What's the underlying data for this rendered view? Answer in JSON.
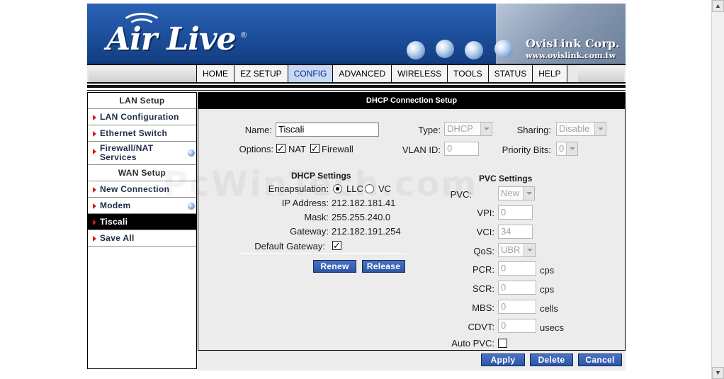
{
  "brand": {
    "logo": "Air Live",
    "reg_mark": "®",
    "corp_name": "OvisLink Corp.",
    "corp_url": "www.ovislink.com.tw"
  },
  "nav": {
    "items": [
      "HOME",
      "EZ SETUP",
      "CONFIG",
      "ADVANCED",
      "WIRELESS",
      "TOOLS",
      "STATUS",
      "HELP"
    ],
    "active": "CONFIG"
  },
  "sidebar": {
    "lan_header": "LAN Setup",
    "lan_configuration": "LAN Configuration",
    "ethernet_switch": "Ethernet Switch",
    "firewall_nat_1": "Firewall/NAT",
    "firewall_nat_2": "Services",
    "wan_header": "WAN Setup",
    "new_connection": "New Connection",
    "modem": "Modem",
    "tiscali": "Tiscali",
    "save_all": "Save All"
  },
  "panel": {
    "title": "DHCP Connection Setup",
    "name_label": "Name:",
    "name_value": "Tiscali",
    "type_label": "Type:",
    "type_value": "DHCP",
    "sharing_label": "Sharing:",
    "sharing_value": "Disable",
    "options_label": "Options:",
    "nat_label": "NAT",
    "firewall_label": "Firewall",
    "vlan_label": "VLAN ID:",
    "vlan_value": "0",
    "priority_label": "Priority Bits:",
    "priority_value": "0"
  },
  "dhcp": {
    "title": "DHCP Settings",
    "encapsulation_label": "Encapsulation:",
    "llc_label": "LLC",
    "vc_label": "VC",
    "ip_label": "IP Address:",
    "ip_value": "212.182.181.41",
    "mask_label": "Mask:",
    "mask_value": "255.255.240.0",
    "gateway_label": "Gateway:",
    "gateway_value": "212.182.191.254",
    "default_gateway_label": "Default Gateway:",
    "renew": "Renew",
    "release": "Release"
  },
  "pvc": {
    "title": "PVC Settings",
    "pvc_label": "PVC:",
    "pvc_value": "New",
    "vpi_label": "VPI:",
    "vpi_value": "0",
    "vci_label": "VCI:",
    "vci_value": "34",
    "qos_label": "QoS:",
    "qos_value": "UBR",
    "pcr_label": "PCR:",
    "pcr_value": "0",
    "pcr_unit": "cps",
    "scr_label": "SCR:",
    "scr_value": "0",
    "scr_unit": "cps",
    "mbs_label": "MBS:",
    "mbs_value": "0",
    "mbs_unit": "cells",
    "cdvt_label": "CDVT:",
    "cdvt_value": "0",
    "cdvt_unit": "usecs",
    "auto_pvc_label": "Auto PVC:"
  },
  "actions": {
    "apply": "Apply",
    "delete": "Delete",
    "cancel": "Cancel"
  },
  "watermark": "PcWinTech.com",
  "colors": {
    "banner_blue": "#1d4e9b",
    "nav_active": "#c7d9f5",
    "button_blue": "#2c55a6",
    "bullet_red": "#d31b1b"
  }
}
